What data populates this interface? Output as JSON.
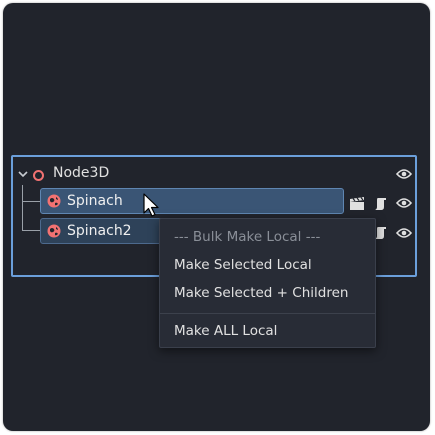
{
  "scene_tree": {
    "root": {
      "label": "Node3D",
      "icon": "node3d-icon",
      "visible": true
    },
    "children": [
      {
        "label": "Spinach",
        "icon": "mesh-globe-icon",
        "selected": true
      },
      {
        "label": "Spinach2",
        "icon": "mesh-globe-icon",
        "selected": false
      }
    ]
  },
  "context_menu": {
    "header": "--- Bulk Make Local ---",
    "items": [
      "Make Selected Local",
      "Make Selected + Children",
      "Make ALL Local"
    ]
  },
  "colors": {
    "panel_bg": "#21242c",
    "focus_border": "#6b9fdb",
    "node3d_accent": "#f27272",
    "selection_bg": "#3a5575"
  }
}
